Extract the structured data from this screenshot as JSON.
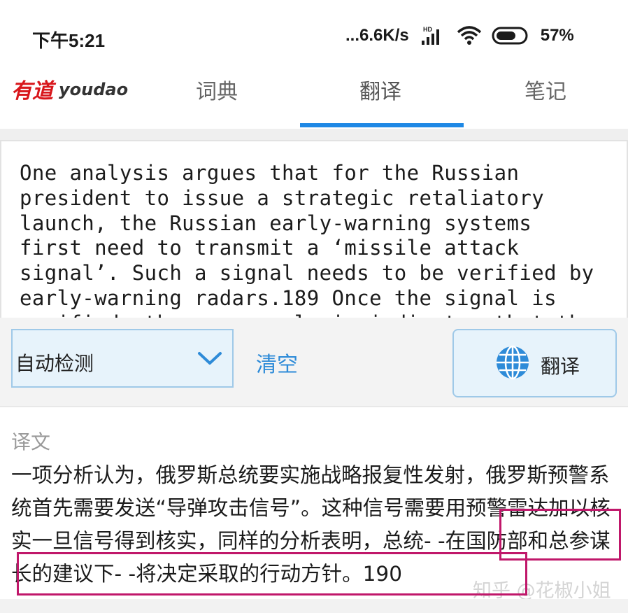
{
  "status_bar": {
    "time": "下午5:21",
    "network_speed": "...6.6K/s",
    "hd_badge": "HD",
    "battery": "57%",
    "icons": [
      "signal-icon",
      "wifi-icon",
      "battery-icon"
    ]
  },
  "app": {
    "logo_cn": "有道",
    "logo_en": "youdao",
    "tabs": [
      {
        "label": "词典",
        "active": false
      },
      {
        "label": "翻译",
        "active": true
      },
      {
        "label": "笔记",
        "active": false
      }
    ],
    "accent_color": "#1e88e5"
  },
  "source": {
    "text": "One analysis argues that for the Russian\npresident to issue a strategic retaliatory\nlaunch, the Russian early-warning systems\nfirst need to transmit a ‘missile attack\nsignal’. Such a signal needs to be verified by\nearly-warning radars.189 Once the signal is\nverified, the same analysis indicates that the"
  },
  "controls": {
    "language_selected": "自动检测",
    "clear_label": "清空",
    "translate_label": "翻译"
  },
  "output": {
    "label": "译文",
    "text": "一项分析认为，俄罗斯总统要实施战略报复性发射，俄罗斯预警系统首先需要发送“导弹攻击信号”。这种信号需要用预警雷达加以核实一旦信号得到核实，同样的分析表明，总统- -在国防部和总参谋长的建议下- -将决定采取的行动方针。190",
    "highlight_color": "#c0176a"
  },
  "watermark": "知乎 @花椒小姐"
}
